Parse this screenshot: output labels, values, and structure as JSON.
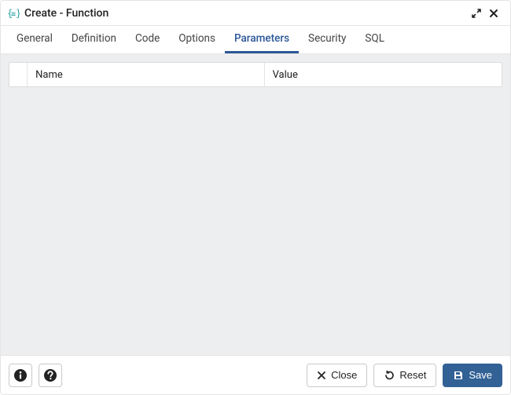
{
  "title": "Create - Function",
  "tabs": [
    {
      "label": "General"
    },
    {
      "label": "Definition"
    },
    {
      "label": "Code"
    },
    {
      "label": "Options"
    },
    {
      "label": "Parameters",
      "active": true
    },
    {
      "label": "Security"
    },
    {
      "label": "SQL"
    }
  ],
  "grid": {
    "columns": {
      "name": "Name",
      "value": "Value"
    },
    "rows": []
  },
  "footer": {
    "close": "Close",
    "reset": "Reset",
    "save": "Save"
  }
}
